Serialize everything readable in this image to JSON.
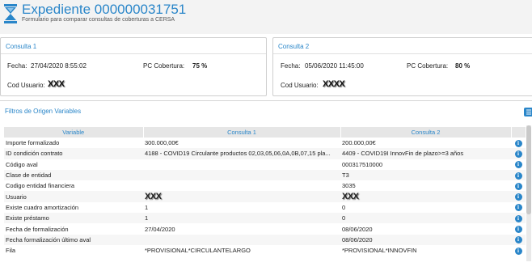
{
  "header": {
    "title": "Expediente 000000031751",
    "subtitle": "Formulario para comparar consultas de coberturas a CERSA"
  },
  "consulta1": {
    "title": "Consulta 1",
    "fecha_label": "Fecha:",
    "fecha_value": "27/04/2020 8:55:02",
    "pc_label": "PC Cobertura:",
    "pc_value": "75 %",
    "cod_label": "Cod Usuario:",
    "cod_value": "XXX"
  },
  "consulta2": {
    "title": "Consulta 2",
    "fecha_label": "Fecha:",
    "fecha_value": "05/06/2020 11:45:00",
    "pc_label": "PC Cobertura:",
    "pc_value": "80 %",
    "cod_label": "Cod Usuario:",
    "cod_value": "XXXX"
  },
  "filtros": {
    "title": "Filtros de Origen Variables"
  },
  "table": {
    "headers": [
      "Variable",
      "Consulta 1",
      "Consulta 2"
    ],
    "rows": [
      {
        "variable": "Importe formalizado",
        "c1": "300.000,00€",
        "c2": "200.000,00€"
      },
      {
        "variable": "ID condición contrato",
        "c1": "4188 - COVID19 Circulante productos 02,03,05,06,0A,0B,07,15 pla...",
        "c2": "4409 - COVID19I InnovFin de plazo>=3 años"
      },
      {
        "variable": "Código aval",
        "c1": "",
        "c2": "000317510000"
      },
      {
        "variable": "Clase de entidad",
        "c1": "",
        "c2": "T3"
      },
      {
        "variable": "Codigo entidad financiera",
        "c1": "",
        "c2": "3035"
      },
      {
        "variable": "Usuario",
        "c1": "XXX",
        "c2": "XXX"
      },
      {
        "variable": "Existe cuadro amortización",
        "c1": "1",
        "c2": "0"
      },
      {
        "variable": "Existe préstamo",
        "c1": "1",
        "c2": "0"
      },
      {
        "variable": "Fecha de formalización",
        "c1": "27/04/2020",
        "c2": "08/06/2020"
      },
      {
        "variable": "Fecha formalización último aval",
        "c1": "",
        "c2": "08/06/2020"
      },
      {
        "variable": "Fila",
        "c1": "*PROVISIONAL*CIRCULANTELARGO",
        "c2": "*PROVISIONAL*INNOVFIN"
      }
    ],
    "info_icon": "i"
  },
  "colors": {
    "accent": "#2a86c9",
    "header_bg": "#f3f3f3",
    "table_header_bg": "#e6e6e6"
  }
}
